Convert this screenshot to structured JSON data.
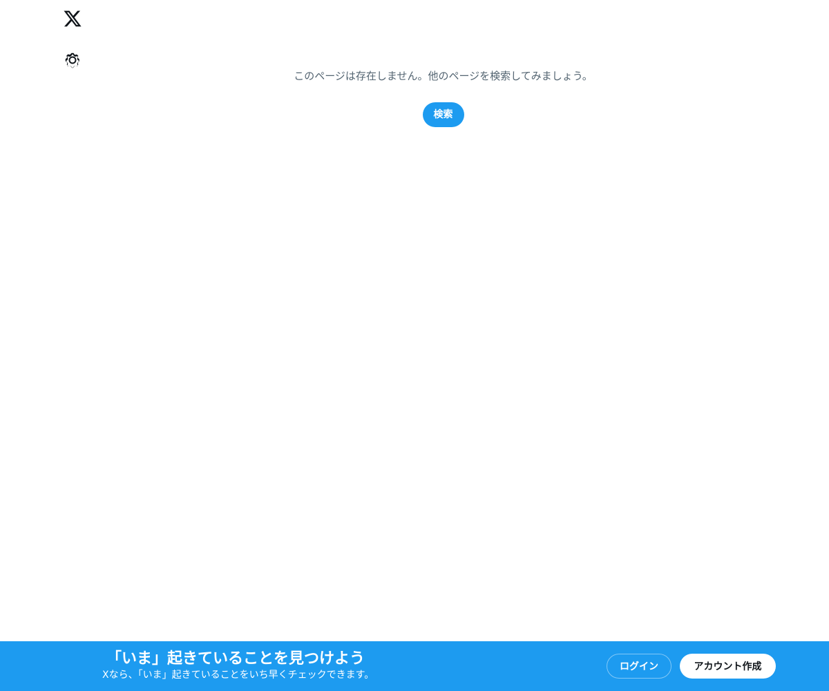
{
  "nav": {
    "logo_icon": "x-logo-icon",
    "settings_icon": "gear-icon"
  },
  "main": {
    "message": "このページは存在しません。他のページを検索してみましょう。",
    "search_button": "検索"
  },
  "banner": {
    "title": "「いま」起きていることを見つけよう",
    "subtitle": "Xなら、「いま」起きていることをいち早くチェックできます。",
    "login_button": "ログイン",
    "signup_button": "アカウント作成"
  },
  "colors": {
    "accent": "#1d9bf0",
    "secondary_text": "#536471",
    "primary_text": "#0f1419"
  }
}
